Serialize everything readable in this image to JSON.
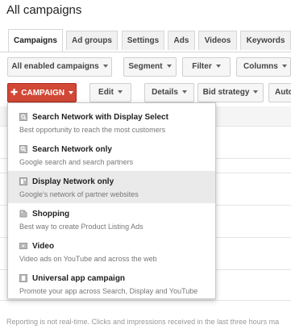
{
  "page": {
    "title": "All campaigns"
  },
  "tabs": [
    {
      "label": "Campaigns",
      "active": true
    },
    {
      "label": "Ad groups",
      "active": false
    },
    {
      "label": "Settings",
      "active": false
    },
    {
      "label": "Ads",
      "active": false
    },
    {
      "label": "Videos",
      "active": false
    },
    {
      "label": "Keywords",
      "active": false
    }
  ],
  "toolbar1": {
    "filter_all": "All enabled campaigns",
    "segment": "Segment",
    "filter": "Filter",
    "columns": "Columns"
  },
  "toolbar2": {
    "campaign": "CAMPAIGN",
    "edit": "Edit",
    "details": "Details",
    "bid_strategy": "Bid strategy",
    "automate": "Auto"
  },
  "menu": {
    "items": [
      {
        "title": "Search Network with Display Select",
        "desc": "Best opportunity to reach the most customers",
        "icon": "search-display-icon",
        "highlighted": false
      },
      {
        "title": "Search Network only",
        "desc": "Google search and search partners",
        "icon": "search-icon",
        "highlighted": false
      },
      {
        "title": "Display Network only",
        "desc": "Google's network of partner websites",
        "icon": "display-icon",
        "highlighted": true
      },
      {
        "title": "Shopping",
        "desc": "Best way to create Product Listing Ads",
        "icon": "shopping-tag-icon",
        "highlighted": false
      },
      {
        "title": "Video",
        "desc": "Video ads on YouTube and across the web",
        "icon": "video-icon",
        "highlighted": false
      },
      {
        "title": "Universal app campaign",
        "desc": "Promote your app across Search, Display and YouTube",
        "icon": "app-icon",
        "highlighted": false
      }
    ]
  },
  "footer": {
    "note": "Reporting is not real-time. Clicks and impressions received in the last three hours ma"
  },
  "colors": {
    "accent_red": "#d14836",
    "highlight": "#eaeaea"
  }
}
